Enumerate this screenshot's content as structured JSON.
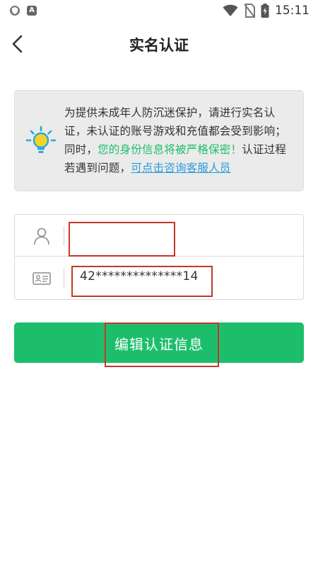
{
  "status_bar": {
    "time": "15:11",
    "left_icons": [
      "shield-icon",
      "a-badge-icon"
    ],
    "right_icons": [
      "wifi-icon",
      "no-sim-icon",
      "battery-charging-icon"
    ]
  },
  "header": {
    "title": "实名认证",
    "back_icon": "chevron-left-icon"
  },
  "notice": {
    "icon": "lightbulb-icon",
    "text_part1": "为提供未成年人防沉迷保护，请进行实名认证，未认证的账号游戏和充值都会受到影响；同时，",
    "text_highlight": "您的身份信息将被严格保密！",
    "text_part2": "认证过程若遇到问题，",
    "link_text": "可点击咨询客服人员"
  },
  "form": {
    "name_field": {
      "icon": "user-icon",
      "value": ""
    },
    "id_field": {
      "icon": "id-card-icon",
      "value": "42**************14"
    }
  },
  "button": {
    "label": "编辑认证信息"
  },
  "colors": {
    "accent_green": "#1dbe6b",
    "link_blue": "#2a9bd8",
    "annotation_red": "#c0392b",
    "notice_bg": "#ebebeb"
  }
}
